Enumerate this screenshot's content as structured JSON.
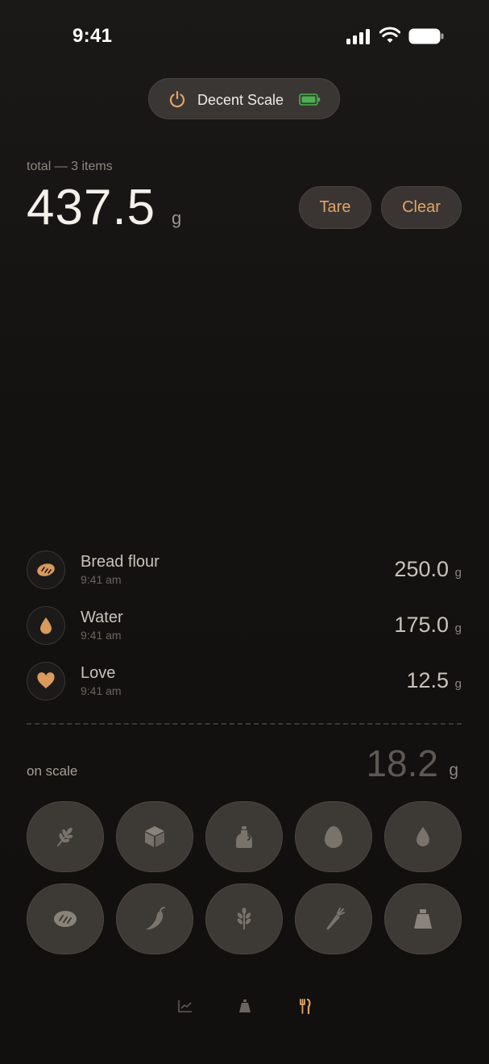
{
  "status_bar": {
    "time": "9:41"
  },
  "device": {
    "name": "Decent Scale"
  },
  "total": {
    "label": "total — 3 items",
    "value": "437.5",
    "unit": "g"
  },
  "actions": {
    "tare": "Tare",
    "clear": "Clear"
  },
  "items": [
    {
      "icon": "bread-icon",
      "name": "Bread flour",
      "time": "9:41 am",
      "value": "250.0",
      "unit": "g"
    },
    {
      "icon": "water-drop-icon",
      "name": "Water",
      "time": "9:41 am",
      "value": "175.0",
      "unit": "g"
    },
    {
      "icon": "heart-icon",
      "name": "Love",
      "time": "9:41 am",
      "value": "12.5",
      "unit": "g"
    }
  ],
  "on_scale": {
    "label": "on scale",
    "value": "18.2",
    "unit": "g"
  },
  "ingredients": [
    "wheat-icon",
    "cube-icon",
    "oil-bottle-icon",
    "egg-icon",
    "water-drop-icon",
    "bread-loaf-icon",
    "chili-icon",
    "herb-icon",
    "carrot-icon",
    "weight-icon"
  ],
  "tabs": [
    {
      "icon": "chart-icon",
      "active": false
    },
    {
      "icon": "scale-icon",
      "active": false
    },
    {
      "icon": "fork-knife-icon",
      "active": true
    }
  ],
  "colors": {
    "accent": "#e3a466",
    "background": "#141210",
    "battery_green": "#4caf50"
  }
}
